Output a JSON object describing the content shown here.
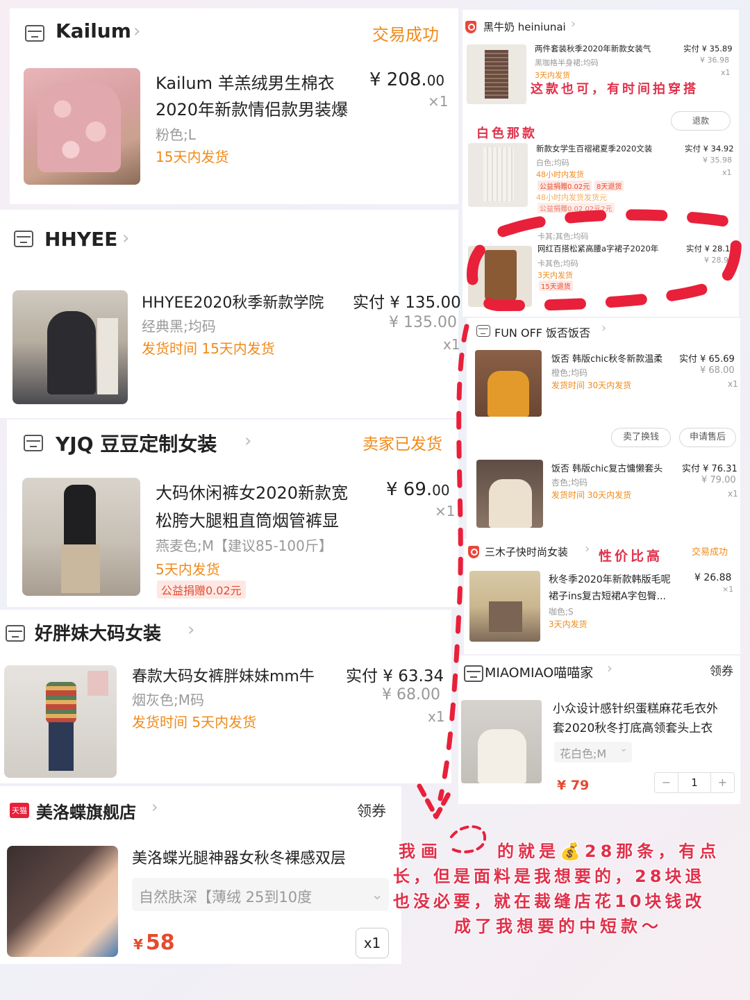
{
  "left": {
    "kailum": {
      "store": "Kailum",
      "status": "交易成功",
      "title_1": "Kailum 羊羔绒男生棉衣",
      "title_2": "2020年新款情侣款男装爆",
      "spec": "粉色;L",
      "ship": "15天内发货",
      "price_main": "¥ 208.",
      "price_cents": "00",
      "qty": "×1"
    },
    "hhyee": {
      "store": "HHYEE",
      "title": "HHYEE2020秋季新款学院",
      "paid": "实付 ¥ 135.00",
      "price": "¥ 135.00",
      "spec": "经典黑;均码",
      "ship": "发货时间  15天内发货",
      "qty": "x1"
    },
    "yjq": {
      "store": "YJQ  豆豆定制女装",
      "status": "卖家已发货",
      "title_1": "大码休闲裤女2020新款宽",
      "title_2": "松胯大腿粗直筒烟管裤显",
      "spec": "燕麦色;M【建议85-100斤】",
      "ship": "5天内发货",
      "charity": "公益捐赠0.02元",
      "price_main": "¥ 69.",
      "price_cents": "00",
      "qty": "×1"
    },
    "haopangmei": {
      "store": "好胖妹大码女装",
      "title": "春款大码女裤胖妹妹mm牛",
      "paid": "实付 ¥ 63.34",
      "price": "¥ 68.00",
      "spec": "烟灰色;M码",
      "ship": "发货时间  5天内发货",
      "qty": "x1"
    },
    "meiluodie": {
      "tmall_badge": "天猫",
      "store": "美洛蝶旗舰店",
      "coupon": "领券",
      "title": "美洛蝶光腿神器女秋冬裸感双层",
      "spec": "自然肤深【薄绒 25到10度",
      "price_symbol": "¥",
      "price": "58",
      "qty": "x1"
    }
  },
  "right": {
    "heiniunai": {
      "store": "黑牛奶 heiniunai",
      "item1": {
        "title": "两件套装秋季2020年新款女装气",
        "spec": "黑咖格半身裙;均码",
        "ship": "3天内发货",
        "paid": "实付 ¥ 35.89",
        "price": "¥ 36.98",
        "qty": "x1"
      },
      "refund_button": "退款",
      "item2": {
        "title": "新款女学生百褶裙夏季2020文装",
        "spec": "白色;均码",
        "ship": "48小时内发货",
        "charity": "公益捐赠0.02元",
        "return_tag": "8天退货",
        "ship_faded": "48小时内发货发货元",
        "charity_faded": "公益捐赠0.02 02元2元",
        "paid": "实付 ¥ 34.92",
        "price": "¥ 35.98",
        "qty": "x1"
      },
      "item3": {
        "spec_top": "卡其;其色;均码",
        "title": "网红百搭松紧高腰a字裙子2020年",
        "spec": "卡其色;均码",
        "ship": "3天内发货",
        "return_tag": "15天退货",
        "paid": "实付 ¥ 28.1",
        "price": "¥ 28.9"
      }
    },
    "funoff": {
      "store": "FUN OFF 饭否饭否",
      "item1": {
        "title": "饭否 韩版chic秋冬新款温柔",
        "paid": "实付 ¥ 65.69",
        "spec": "橙色;均码",
        "price": "¥ 68.00",
        "ship": "发货时间  30天内发货",
        "qty": "x1"
      },
      "sell_button": "卖了换钱",
      "aftersale_button": "申请售后",
      "item2": {
        "title": "饭否 韩版chic复古慵懒套头",
        "paid": "实付 ¥ 76.31",
        "spec": "杏色;均码",
        "price": "¥ 79.00",
        "ship": "发货时间  30天内发货",
        "qty": "x1"
      }
    },
    "sanmuzi": {
      "store": "三木子快时尚女装",
      "status": "交易成功",
      "title_1": "秋冬季2020年新款韩版毛呢",
      "title_2": "裙子ins复古短裙A字包臀...",
      "price": "¥ 26.88",
      "qty": "×1",
      "spec": "咖色;S",
      "ship": "3天内发货"
    },
    "miaomiao": {
      "store": "MIAOMIAO喵喵家",
      "coupon": "领券",
      "title_1": "小众设计感针织蛋糕麻花毛衣外",
      "title_2": "套2020秋冬打底高领套头上衣",
      "spec": "花白色;M",
      "price": "¥ 79",
      "qty_value": "1",
      "minus": "−",
      "plus": "+"
    }
  },
  "annotations": {
    "this_one": "这款也可，有时间拍穿搭",
    "white_set": "白色那款",
    "value": "性价比高",
    "bottom_line1_a": "我画",
    "bottom_line1_b": "的就是💰28那条，有点",
    "bottom_line2": "长，但是面料是我想要的，28块退",
    "bottom_line3": "也没必要，就在裁缝店花10块钱改",
    "bottom_line4": "成了我想要的中短款～"
  },
  "colors": {
    "orange": "#f08a1a",
    "red_price": "#e54a2e",
    "annotation": "#e0304a",
    "dashed_loop": "#e8203a"
  }
}
